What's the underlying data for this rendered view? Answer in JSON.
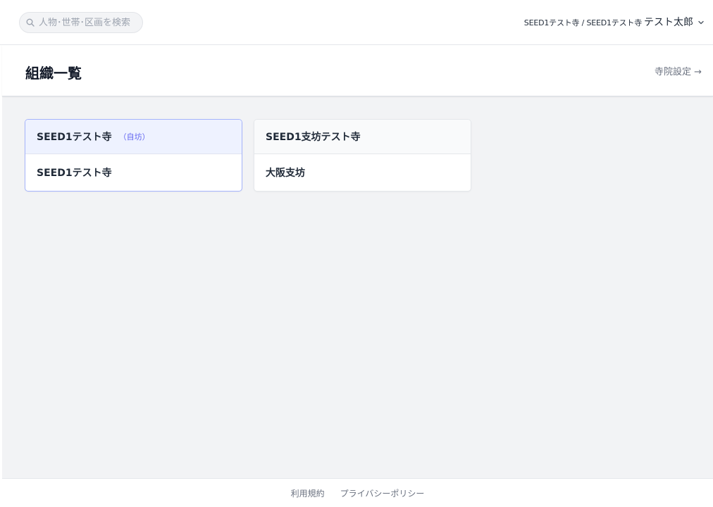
{
  "search": {
    "placeholder": "人物･世帯･区画を検索",
    "value": ""
  },
  "header": {
    "org_path": "SEED1テスト寺 / SEED1テスト寺",
    "user_name": "テスト太郎",
    "icons": {
      "search": "search-icon",
      "user_menu": "chevron-down-icon"
    }
  },
  "page": {
    "title": "組織一覧",
    "settings_link": "寺院設定 →"
  },
  "organizations": [
    {
      "name": "SEED1テスト寺",
      "badge": "（自坊）",
      "items": [
        "SEED1テスト寺"
      ]
    },
    {
      "name": "SEED1支坊テスト寺",
      "badge": "",
      "items": [
        "大阪支坊"
      ]
    }
  ],
  "footer": {
    "terms": "利用規約",
    "privacy": "プライバシーポリシー"
  },
  "colors": {
    "accent": "#6366f1",
    "own_card_header": "#eef2ff",
    "page_background": "#f2f3f5"
  }
}
